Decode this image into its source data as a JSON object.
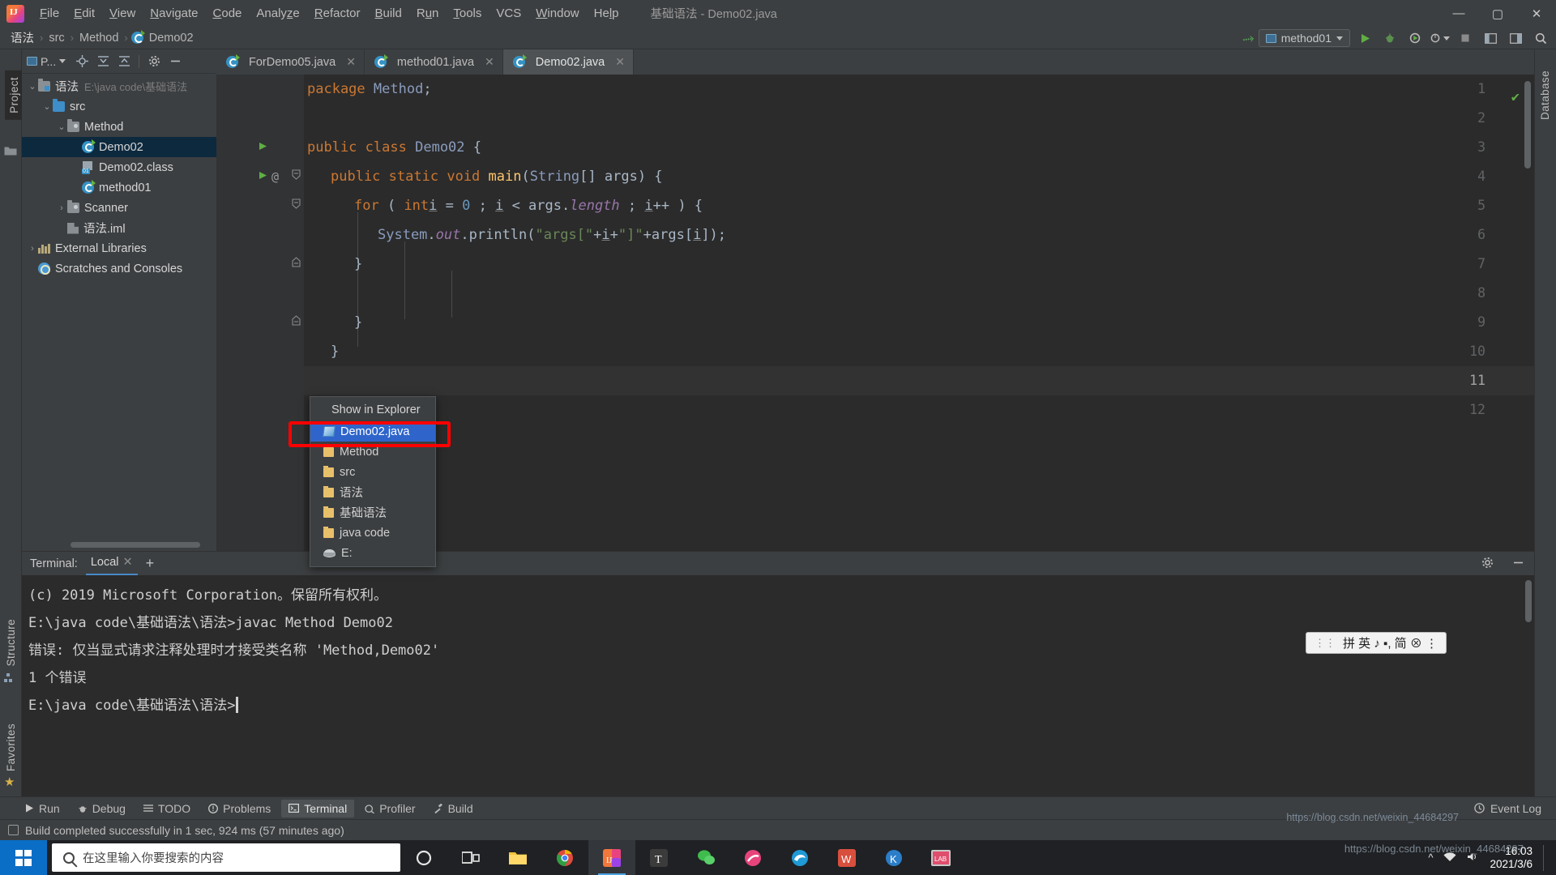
{
  "window": {
    "title": "基础语法 - Demo02.java",
    "minimize": "—",
    "maximize": "▢",
    "close": "✕"
  },
  "menubar": {
    "items": [
      {
        "label": "File"
      },
      {
        "label": "Edit"
      },
      {
        "label": "View"
      },
      {
        "label": "Navigate"
      },
      {
        "label": "Code"
      },
      {
        "label": "Analyze"
      },
      {
        "label": "Refactor"
      },
      {
        "label": "Build"
      },
      {
        "label": "Run"
      },
      {
        "label": "Tools"
      },
      {
        "label": "VCS"
      },
      {
        "label": "Window"
      },
      {
        "label": "Help"
      }
    ]
  },
  "breadcrumb": {
    "items": [
      "语法",
      "src",
      "Method",
      "Demo02"
    ],
    "separator": "›"
  },
  "toolbar_right": {
    "run_config": "method01",
    "run_tooltip": "Run",
    "debug_tooltip": "Debug",
    "coverage_tooltip": "Run with Coverage",
    "profiler_tooltip": "Profiler",
    "stop_tooltip": "Stop",
    "search_tooltip": "Search Everywhere"
  },
  "tool_strips": {
    "left": [
      "Project",
      "Structure",
      "Favorites"
    ],
    "right": [
      "Database"
    ]
  },
  "project_panel": {
    "title": "P...",
    "toolbar_icons": [
      "locate-icon",
      "expand-all-icon",
      "collapse-all-icon",
      "settings-icon",
      "hide-icon"
    ],
    "tree": [
      {
        "label": "语法",
        "detail": "E:\\java code\\基础语法",
        "indent": 0,
        "arrow": "v",
        "icon": "module-folder-icon",
        "selected": false
      },
      {
        "label": "src",
        "detail": "",
        "indent": 1,
        "arrow": "v",
        "icon": "source-folder-icon",
        "selected": false
      },
      {
        "label": "Method",
        "detail": "",
        "indent": 2,
        "arrow": "v",
        "icon": "package-folder-icon",
        "selected": false
      },
      {
        "label": "Demo02",
        "detail": "",
        "indent": 3,
        "arrow": "",
        "icon": "java-class-icon",
        "selected": true
      },
      {
        "label": "Demo02.class",
        "detail": "",
        "indent": 3,
        "arrow": "",
        "icon": "compiled-class-icon",
        "selected": false
      },
      {
        "label": "method01",
        "detail": "",
        "indent": 3,
        "arrow": "",
        "icon": "java-class-icon",
        "selected": false
      },
      {
        "label": "Scanner",
        "detail": "",
        "indent": 2,
        "arrow": ">",
        "icon": "package-folder-icon",
        "selected": false
      },
      {
        "label": "语法.iml",
        "detail": "",
        "indent": 2,
        "arrow": "",
        "icon": "iml-file-icon",
        "selected": false
      },
      {
        "label": "External Libraries",
        "detail": "",
        "indent": 0,
        "arrow": ">",
        "icon": "library-icon",
        "selected": false
      },
      {
        "label": "Scratches and Consoles",
        "detail": "",
        "indent": 0,
        "arrow": "",
        "icon": "scratches-icon",
        "selected": false
      }
    ]
  },
  "editor": {
    "tabs": [
      {
        "label": "ForDemo05.java",
        "active": false
      },
      {
        "label": "method01.java",
        "active": false
      },
      {
        "label": "Demo02.java",
        "active": true
      }
    ],
    "close_glyph": "✕",
    "current_line": 11,
    "lines": [
      {
        "no": 1,
        "tokens": [
          {
            "t": "kw",
            "v": "package"
          },
          {
            "t": "txt",
            "v": " "
          },
          {
            "t": "stat",
            "v": "Method"
          },
          {
            "t": "txt",
            "v": ";"
          }
        ],
        "indent": 0
      },
      {
        "no": 2,
        "tokens": [],
        "indent": 0
      },
      {
        "no": 3,
        "tokens": [
          {
            "t": "kw",
            "v": "public"
          },
          {
            "t": "txt",
            "v": " "
          },
          {
            "t": "kw",
            "v": "class"
          },
          {
            "t": "txt",
            "v": " "
          },
          {
            "t": "stat",
            "v": "Demo02"
          },
          {
            "t": "txt",
            "v": " {"
          }
        ],
        "indent": 0,
        "run_marker": true
      },
      {
        "no": 4,
        "tokens": [
          {
            "t": "kw",
            "v": "public"
          },
          {
            "t": "txt",
            "v": " "
          },
          {
            "t": "kw",
            "v": "static"
          },
          {
            "t": "txt",
            "v": " "
          },
          {
            "t": "kw",
            "v": "void"
          },
          {
            "t": "txt",
            "v": " "
          },
          {
            "t": "fn",
            "v": "main"
          },
          {
            "t": "txt",
            "v": "("
          },
          {
            "t": "stat",
            "v": "String"
          },
          {
            "t": "txt",
            "v": "[] args) {"
          }
        ],
        "indent": 1,
        "run_marker": true,
        "at_marker": true,
        "fold": "−"
      },
      {
        "no": 5,
        "tokens": [
          {
            "t": "kw",
            "v": "for"
          },
          {
            "t": "txt",
            "v": " ( "
          },
          {
            "t": "kw",
            "v": "int"
          },
          {
            "t": "und",
            "v": "i"
          },
          {
            "t": "txt",
            "v": " = "
          },
          {
            "t": "num",
            "v": "0"
          },
          {
            "t": "txt",
            "v": " ; "
          },
          {
            "t": "und",
            "v": "i"
          },
          {
            "t": "txt",
            "v": " < args."
          },
          {
            "t": "fld2",
            "v": "length"
          },
          {
            "t": "txt",
            "v": " ; "
          },
          {
            "t": "und",
            "v": "i"
          },
          {
            "t": "txt",
            "v": "++ ) {"
          }
        ],
        "indent": 2,
        "fold": "−"
      },
      {
        "no": 6,
        "tokens": [
          {
            "t": "stat",
            "v": "System"
          },
          {
            "t": "txt",
            "v": "."
          },
          {
            "t": "fld",
            "v": "out"
          },
          {
            "t": "txt",
            "v": ".println("
          },
          {
            "t": "str",
            "v": "\"args[\""
          },
          {
            "t": "txt",
            "v": "+"
          },
          {
            "t": "und",
            "v": "i"
          },
          {
            "t": "txt",
            "v": "+"
          },
          {
            "t": "str",
            "v": "\"]\""
          },
          {
            "t": "txt",
            "v": "+args["
          },
          {
            "t": "und",
            "v": "i"
          },
          {
            "t": "txt",
            "v": "]);"
          }
        ],
        "indent": 3
      },
      {
        "no": 7,
        "tokens": [
          {
            "t": "txt",
            "v": "}"
          }
        ],
        "indent": 2,
        "fold": "△"
      },
      {
        "no": 8,
        "tokens": [],
        "indent": 0
      },
      {
        "no": 9,
        "tokens": [
          {
            "t": "txt",
            "v": "}"
          }
        ],
        "indent": 2,
        "fold": "△"
      },
      {
        "no": 10,
        "tokens": [
          {
            "t": "txt",
            "v": "}"
          }
        ],
        "indent": 1
      },
      {
        "no": 11,
        "tokens": [],
        "indent": 0
      },
      {
        "no": 12,
        "tokens": [],
        "indent": 0
      }
    ],
    "raw_lines": [
      "package Method;",
      "",
      "public class Demo02 {",
      "    public static void main(String[] args) {",
      "        for ( int i = 0 ; i < args.length ; i++ ) {",
      "            System.out.println(\"args[\"+i+\"]\"+args[i]);",
      "        }",
      "",
      "        }",
      "    }",
      "",
      ""
    ],
    "inspection_status": "✔"
  },
  "popup": {
    "header": "Show in Explorer",
    "items": [
      {
        "label": "Demo02.java",
        "icon": "java-file-icon",
        "selected": true
      },
      {
        "label": "Method",
        "icon": "folder-icon",
        "selected": false
      },
      {
        "label": "src",
        "icon": "folder-icon",
        "selected": false
      },
      {
        "label": "语法",
        "icon": "folder-icon",
        "selected": false
      },
      {
        "label": "基础语法",
        "icon": "folder-icon",
        "selected": false
      },
      {
        "label": "java code",
        "icon": "folder-icon",
        "selected": false
      },
      {
        "label": "E:",
        "icon": "drive-icon",
        "selected": false
      }
    ]
  },
  "terminal": {
    "label": "Terminal:",
    "tab": "Local",
    "tab_close": "✕",
    "add": "+",
    "settings_icon": "gear-icon",
    "hide_icon": "minimize-icon",
    "output": [
      "(c) 2019 Microsoft Corporation。保留所有权利。",
      "",
      "E:\\java code\\基础语法\\语法>javac Method Demo02",
      "错误: 仅当显式请求注释处理时才接受类名称 'Method,Demo02'",
      "1 个错误",
      "",
      "E:\\java code\\基础语法\\语法>"
    ]
  },
  "ime": {
    "text": "拼 英 ♪ ▪, 简 ⊗ ⋮"
  },
  "bottom_tabs": [
    {
      "label": "Run",
      "icon": "play-icon",
      "active": false
    },
    {
      "label": "Debug",
      "icon": "bug-icon",
      "active": false
    },
    {
      "label": "TODO",
      "icon": "list-icon",
      "active": false
    },
    {
      "label": "Problems",
      "icon": "warning-icon",
      "active": false
    },
    {
      "label": "Terminal",
      "icon": "terminal-icon",
      "active": true
    },
    {
      "label": "Profiler",
      "icon": "profiler-icon",
      "active": false
    },
    {
      "label": "Build",
      "icon": "hammer-icon",
      "active": false
    }
  ],
  "event_log": "Event Log",
  "statusbar": {
    "message": "Build completed successfully in 1 sec, 924 ms (57 minutes ago)"
  },
  "taskbar": {
    "search_placeholder": "在这里输入你要搜索的内容",
    "apps": [
      "cortana-icon",
      "task-view-icon",
      "file-explorer-icon",
      "chrome-icon",
      "intellij-icon",
      "typora-icon",
      "wechat-icon",
      "browser-icon",
      "edge-icon",
      "wps-icon",
      "kugou-icon",
      "app-icon"
    ],
    "time": "16:03",
    "date": "2021/3/6"
  },
  "watermark": "https://blog.csdn.net/weixin_44684297",
  "colors": {
    "accent": "#3592c4",
    "selection": "#2f65ca",
    "tree_selection": "#0d293e",
    "keyword": "#cc7832",
    "string": "#6a8759",
    "number": "#6897bb",
    "function": "#ffc66d",
    "field": "#9876aa",
    "text": "#a9b7c6",
    "editor_bg": "#2b2b2b",
    "panel_bg": "#3c3f41",
    "red_highlight": "#ff0000"
  }
}
